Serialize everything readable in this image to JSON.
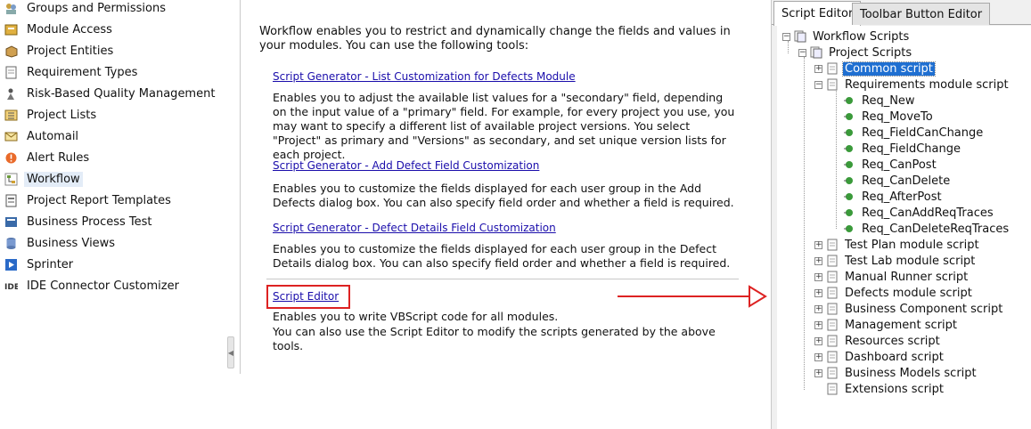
{
  "nav": {
    "items": [
      {
        "label": "Groups and Permissions",
        "icon": "groups-icon",
        "selected": false
      },
      {
        "label": "Module Access",
        "icon": "module-access-icon",
        "selected": false
      },
      {
        "label": "Project Entities",
        "icon": "entities-icon",
        "selected": false
      },
      {
        "label": "Requirement Types",
        "icon": "requirement-types-icon",
        "selected": false
      },
      {
        "label": "Risk-Based Quality Management",
        "icon": "risk-icon",
        "selected": false
      },
      {
        "label": "Project Lists",
        "icon": "lists-icon",
        "selected": false
      },
      {
        "label": "Automail",
        "icon": "mail-icon",
        "selected": false
      },
      {
        "label": "Alert Rules",
        "icon": "alert-icon",
        "selected": false
      },
      {
        "label": "Workflow",
        "icon": "workflow-icon",
        "selected": true
      },
      {
        "label": "Project Report Templates",
        "icon": "report-icon",
        "selected": false
      },
      {
        "label": "Business Process Test",
        "icon": "bpt-icon",
        "selected": false
      },
      {
        "label": "Business Views",
        "icon": "views-icon",
        "selected": false
      },
      {
        "label": "Sprinter",
        "icon": "sprinter-icon",
        "selected": false
      },
      {
        "label": "IDE Connector Customizer",
        "icon": "ide-icon",
        "selected": false
      }
    ]
  },
  "workflow": {
    "intro": "Workflow enables you to restrict and dynamically change the fields and values in your modules. You can use the following tools:",
    "tools": [
      {
        "link": "Script Generator - List Customization for Defects Module",
        "desc": "Enables you to adjust the available list values for a \"secondary\" field, depending on the input value of a \"primary\" field. For example, for every project you use, you may want to specify a different list of available project versions. You select \"Project\" as primary and \"Versions\" as secondary, and set unique version lists for each project."
      },
      {
        "link": "Script Generator - Add Defect Field Customization",
        "desc": "Enables you to customize the fields displayed for each user group in the Add Defects dialog box. You can also specify field order and whether a field is required."
      },
      {
        "link": "Script Generator - Defect Details Field Customization",
        "desc": "Enables you to customize the fields displayed for each user group in the Defect Details dialog box. You can also specify field order and whether a field is required."
      },
      {
        "link": "Script Editor",
        "desc_line1": "Enables you to write VBScript code for all modules.",
        "desc_line2": "You can also use the Script Editor to modify the scripts generated by the above tools."
      }
    ]
  },
  "colors": {
    "highlight": "#d22222",
    "link": "#1a0dab",
    "selection": "#1f6fd1"
  },
  "right_panel": {
    "tabs": [
      {
        "label": "Script Editor",
        "active": true
      },
      {
        "label": "Toolbar Button Editor",
        "active": false
      }
    ],
    "tree": {
      "root": "Workflow Scripts",
      "project": "Project Scripts",
      "common": "Common script",
      "requirements": "Requirements module script",
      "req_events": [
        "Req_New",
        "Req_MoveTo",
        "Req_FieldCanChange",
        "Req_FieldChange",
        "Req_CanPost",
        "Req_CanDelete",
        "Req_AfterPost",
        "Req_CanAddReqTraces",
        "Req_CanDeleteReqTraces"
      ],
      "modules": [
        "Test Plan module script",
        "Test Lab module script",
        "Manual Runner script",
        "Defects module script",
        "Business Component script",
        "Management script",
        "Resources script",
        "Dashboard script",
        "Business Models script"
      ],
      "extensions": "Extensions script"
    }
  }
}
